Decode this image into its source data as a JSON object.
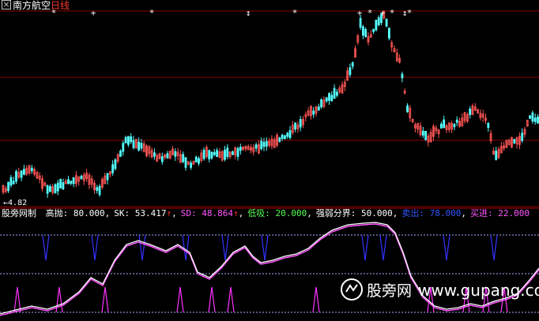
{
  "window": {
    "stock_name": "南方航空",
    "period": "日线",
    "low_price_label": "4.82"
  },
  "indicator": {
    "name": "股旁网制",
    "params": [
      {
        "label": "高抛:",
        "value": "80.000",
        "color": "#ffffff"
      },
      {
        "label": "SK:",
        "value": "53.417",
        "arrow": "↑",
        "color": "#ffffff"
      },
      {
        "label": "SD:",
        "value": "48.864",
        "arrow": "↑",
        "color": "#ff55ff"
      },
      {
        "label": "低吸:",
        "value": "20.000",
        "color": "#55ff55"
      },
      {
        "label": "强弱分界:",
        "value": "50.000",
        "color": "#ffffff"
      },
      {
        "label": "卖出:",
        "value": "78.000",
        "color": "#3355ff"
      },
      {
        "label": "买进:",
        "value": "22.000",
        "color": "#ff55ff"
      }
    ]
  },
  "watermark": {
    "text": "股旁网",
    "url": "www.gupang.com"
  },
  "colors": {
    "background": "#000000",
    "grid": "#8b0000",
    "up_candle": "#ff5555",
    "down_candle": "#55ffff",
    "sk_line": "#ffffff",
    "sd_line": "#ff55ff",
    "sell_signal": "#3333ff",
    "buy_signal": "#ff33ff",
    "dotted_ref": "#aaaaff",
    "title_stock": "#ffffff",
    "title_period": "#ff3333",
    "markers": "#ffffff"
  },
  "chart_data": {
    "type": "candlestick",
    "price_panel": {
      "low_label": 4.82,
      "marker_glyphs": [
        "*",
        "+",
        "*",
        "↕",
        "*",
        "+",
        "*",
        "↕",
        "*",
        "*"
      ]
    },
    "indicator_panel": {
      "high_sell_level": 80,
      "low_buy_level": 20,
      "divider_level": 50,
      "sell_level": 78,
      "buy_level": 22,
      "sk_last": 53.417,
      "sd_last": 48.864
    }
  }
}
